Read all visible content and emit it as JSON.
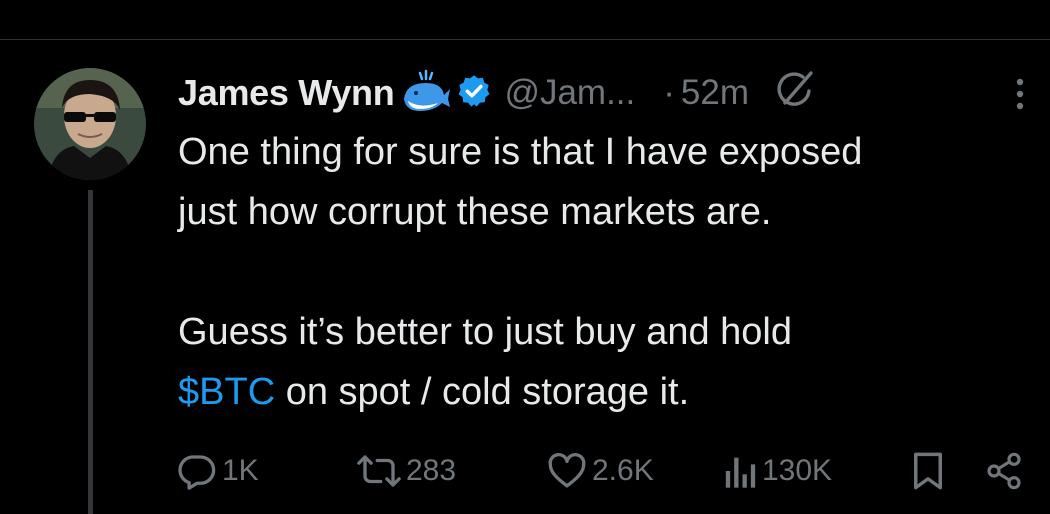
{
  "author": {
    "display_name": "James Wynn",
    "handle": "@Jam...",
    "dot": "·",
    "timestamp": "52m",
    "badges": [
      "whale-icon",
      "verified-icon"
    ],
    "verified_color": "#1d9bf0"
  },
  "tweet": {
    "line1": "One thing for sure is that I have exposed",
    "line2": "just how corrupt these markets are.",
    "line3": "Guess it’s better to just buy and hold",
    "cashtag": "$BTC",
    "line4_rest": " on spot / cold storage it."
  },
  "actions": {
    "replies": "1K",
    "reposts": "283",
    "likes": "2.6K",
    "views": "130K"
  },
  "icons": {
    "reply": "reply-icon",
    "repost": "repost-icon",
    "like": "like-icon",
    "views": "views-icon",
    "bookmark": "bookmark-icon",
    "share": "share-icon",
    "grok": "grok-icon",
    "more": "more-icon"
  },
  "colors": {
    "background": "#000000",
    "text": "#e7e9ea",
    "secondary": "#71767b",
    "accent": "#1d9bf0"
  }
}
